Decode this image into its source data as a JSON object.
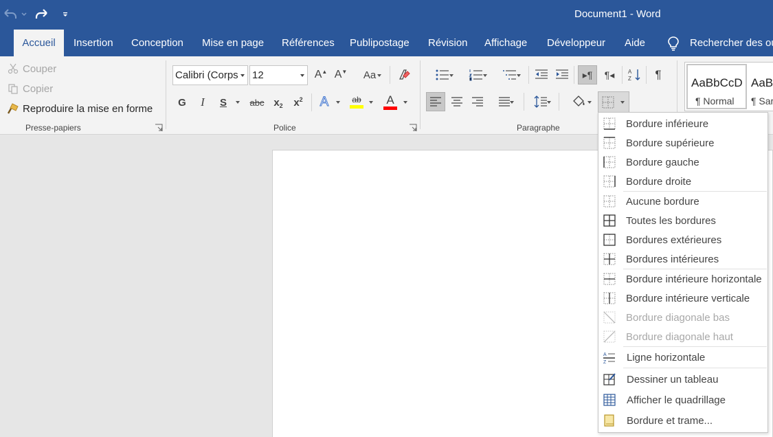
{
  "titlebar": {
    "doc_name": "Document1",
    "separator": " - ",
    "app_name": "Word"
  },
  "tabs": [
    {
      "label": "Accueil",
      "active": true
    },
    {
      "label": "Insertion"
    },
    {
      "label": "Conception"
    },
    {
      "label": "Mise en page"
    },
    {
      "label": "Références"
    },
    {
      "label": "Publipostage"
    },
    {
      "label": "Révision"
    },
    {
      "label": "Affichage"
    },
    {
      "label": "Développeur"
    },
    {
      "label": "Aide"
    }
  ],
  "search": {
    "label": "Rechercher des ou"
  },
  "clipboard": {
    "cut": "Couper",
    "copy": "Copier",
    "format_painter": "Reproduire la mise en forme",
    "group_label": "Presse-papiers"
  },
  "font": {
    "family": "Calibri (Corps",
    "size": "12",
    "change_case": "Aa",
    "bold": "G",
    "italic": "I",
    "underline": "S",
    "strike": "abc",
    "subscript": "x",
    "superscript": "x",
    "sub_mark": "2",
    "grow": "A",
    "shrink": "A",
    "highlight_mark": "ab",
    "font_color_mark": "A",
    "group_label": "Police",
    "colors": {
      "highlight": "#ffff00",
      "font": "#ff0000",
      "text_effects": "#4a7bd0"
    }
  },
  "paragraph": {
    "group_label": "Paragraphe",
    "pilcrow": "¶"
  },
  "styles": {
    "items": [
      {
        "sample": "AaBbCcD",
        "name": "¶ Normal"
      },
      {
        "sample": "AaBb",
        "name": "¶ Sar"
      }
    ]
  },
  "border_menu": {
    "items": [
      {
        "label": "Bordure inférieure"
      },
      {
        "label": "Bordure supérieure"
      },
      {
        "label": "Bordure gauche"
      },
      {
        "label": "Bordure droite"
      },
      {
        "label": "Aucune bordure"
      },
      {
        "label": "Toutes les bordures"
      },
      {
        "label": "Bordures extérieures"
      },
      {
        "label": "Bordures intérieures"
      },
      {
        "label": "Bordure intérieure horizontale"
      },
      {
        "label": "Bordure intérieure verticale"
      },
      {
        "label": "Bordure diagonale bas",
        "disabled": true
      },
      {
        "label": "Bordure diagonale haut",
        "disabled": true
      },
      {
        "label": "Ligne horizontale"
      },
      {
        "label": "Dessiner un tableau"
      },
      {
        "label": "Afficher le quadrillage"
      },
      {
        "label": "Bordure et trame..."
      }
    ]
  },
  "colors": {
    "brand": "#2b579a",
    "ribbon": "#f3f3f3",
    "canvas": "#e6e6e6"
  }
}
